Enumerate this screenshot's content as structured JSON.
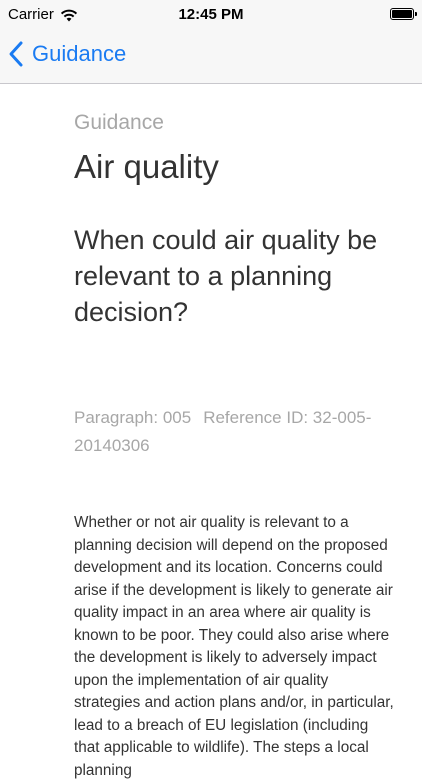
{
  "status_bar": {
    "carrier": "Carrier",
    "time": "12:45 PM",
    "battery_level": 1.0,
    "wifi_icon": "wifi-icon",
    "battery_icon": "battery-icon"
  },
  "nav": {
    "back_label": "Guidance",
    "back_icon": "chevron-left-icon",
    "accent_color": "#1a7bf2"
  },
  "article": {
    "breadcrumb": "Guidance",
    "title": "Air quality",
    "question": "When could air quality be relevant to a planning decision?",
    "paragraph": "Paragraph: 005",
    "reference_id": "Reference ID: 32-005-20140306",
    "body": "Whether or not air quality is relevant to a planning decision will depend on the proposed development and its location. Concerns could arise if the development is likely to generate air quality impact in an area where air quality is known to be poor. They could also arise where the development is likely to adversely impact upon the implementation of air quality strategies and action plans and/or, in particular, lead to a breach of EU legislation (including that applicable to wildlife). The steps a local planning"
  }
}
